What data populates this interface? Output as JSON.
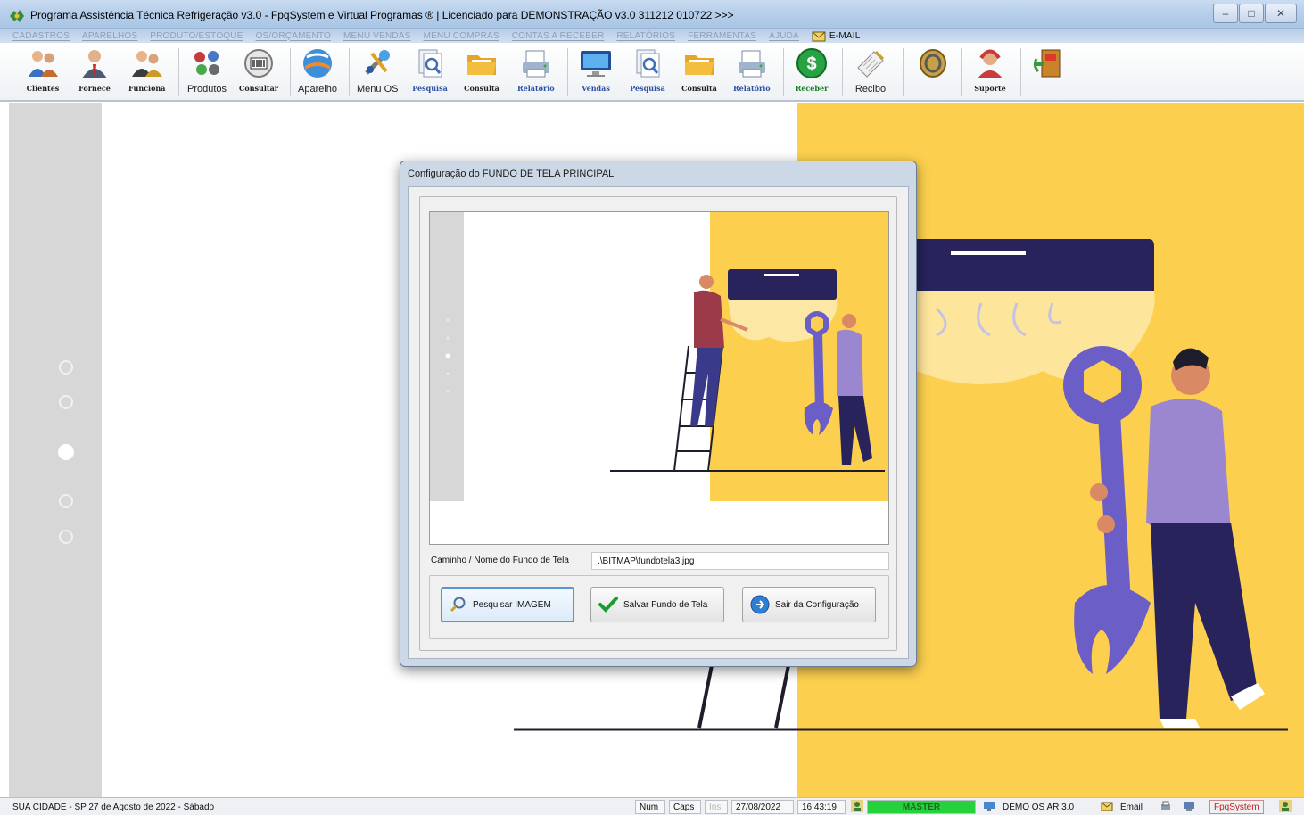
{
  "window": {
    "title": "Programa Assistência Técnica Refrigeração v3.0 - FpqSystem e Virtual Programas ® | Licenciado para  DEMONSTRAÇÃO v3.0 311212 010722 >>>",
    "controls": {
      "minimize": "–",
      "maximize": "□",
      "close": "✕"
    }
  },
  "menu": [
    "CADASTROS",
    "APARELHOS",
    "PRODUTO/ESTOQUE",
    "OS/ORÇAMENTO",
    "MENU VENDAS",
    "MENU COMPRAS",
    "CONTAS A RECEBER",
    "RELATÓRIOS",
    "FERRAMENTAS",
    "AJUDA"
  ],
  "menu_email": "E-MAIL",
  "toolbar": [
    {
      "label": "Clientes",
      "icon": "clients-icon"
    },
    {
      "label": "Fornece",
      "icon": "supplier-icon"
    },
    {
      "label": "Funciona",
      "icon": "employee-icon"
    },
    {
      "label": "Produtos",
      "icon": "products-icon"
    },
    {
      "label": "Consultar",
      "icon": "barcode-icon"
    },
    {
      "label": "Aparelho",
      "icon": "device-icon"
    },
    {
      "label": "Menu OS",
      "icon": "tools-icon"
    },
    {
      "label": "Pesquisa",
      "icon": "search-doc-icon"
    },
    {
      "label": "Consulta",
      "icon": "folder-icon"
    },
    {
      "label": "Relatório",
      "icon": "report-icon"
    },
    {
      "label": "Vendas",
      "icon": "monitor-icon"
    },
    {
      "label": "Pesquisa",
      "icon": "search-doc-icon"
    },
    {
      "label": "Consulta",
      "icon": "folder-icon"
    },
    {
      "label": "Relatório",
      "icon": "report-icon"
    },
    {
      "label": "Receber",
      "icon": "dollar-icon"
    },
    {
      "label": "Recibo",
      "icon": "receipt-icon"
    },
    {
      "label": "",
      "icon": "coin-icon"
    },
    {
      "label": "Suporte",
      "icon": "support-icon"
    },
    {
      "label": "",
      "icon": "exit-icon"
    }
  ],
  "dialog": {
    "title": "Configuração do FUNDO DE TELA PRINCIPAL",
    "path_label": "Caminho / Nome do Fundo de Tela",
    "path_value": ".\\BITMAP\\fundotela3.jpg",
    "buttons": {
      "search": "Pesquisar IMAGEM",
      "save": "Salvar Fundo de Tela",
      "exit": "Sair da Configuração"
    }
  },
  "statusbar": {
    "location": "SUA CIDADE - SP 27 de Agosto de 2022 - Sábado",
    "num": "Num",
    "caps": "Caps",
    "ins": "Ins",
    "date": "27/08/2022",
    "time": "16:43:19",
    "user": "MASTER",
    "demo": "DEMO OS AR 3.0",
    "email": "Email",
    "brand": "FpqSystem"
  },
  "colors": {
    "accent_yellow": "#fcd04e",
    "figure_purple": "#6b5fc7",
    "navy": "#28235a",
    "master_green": "#26d23c"
  }
}
